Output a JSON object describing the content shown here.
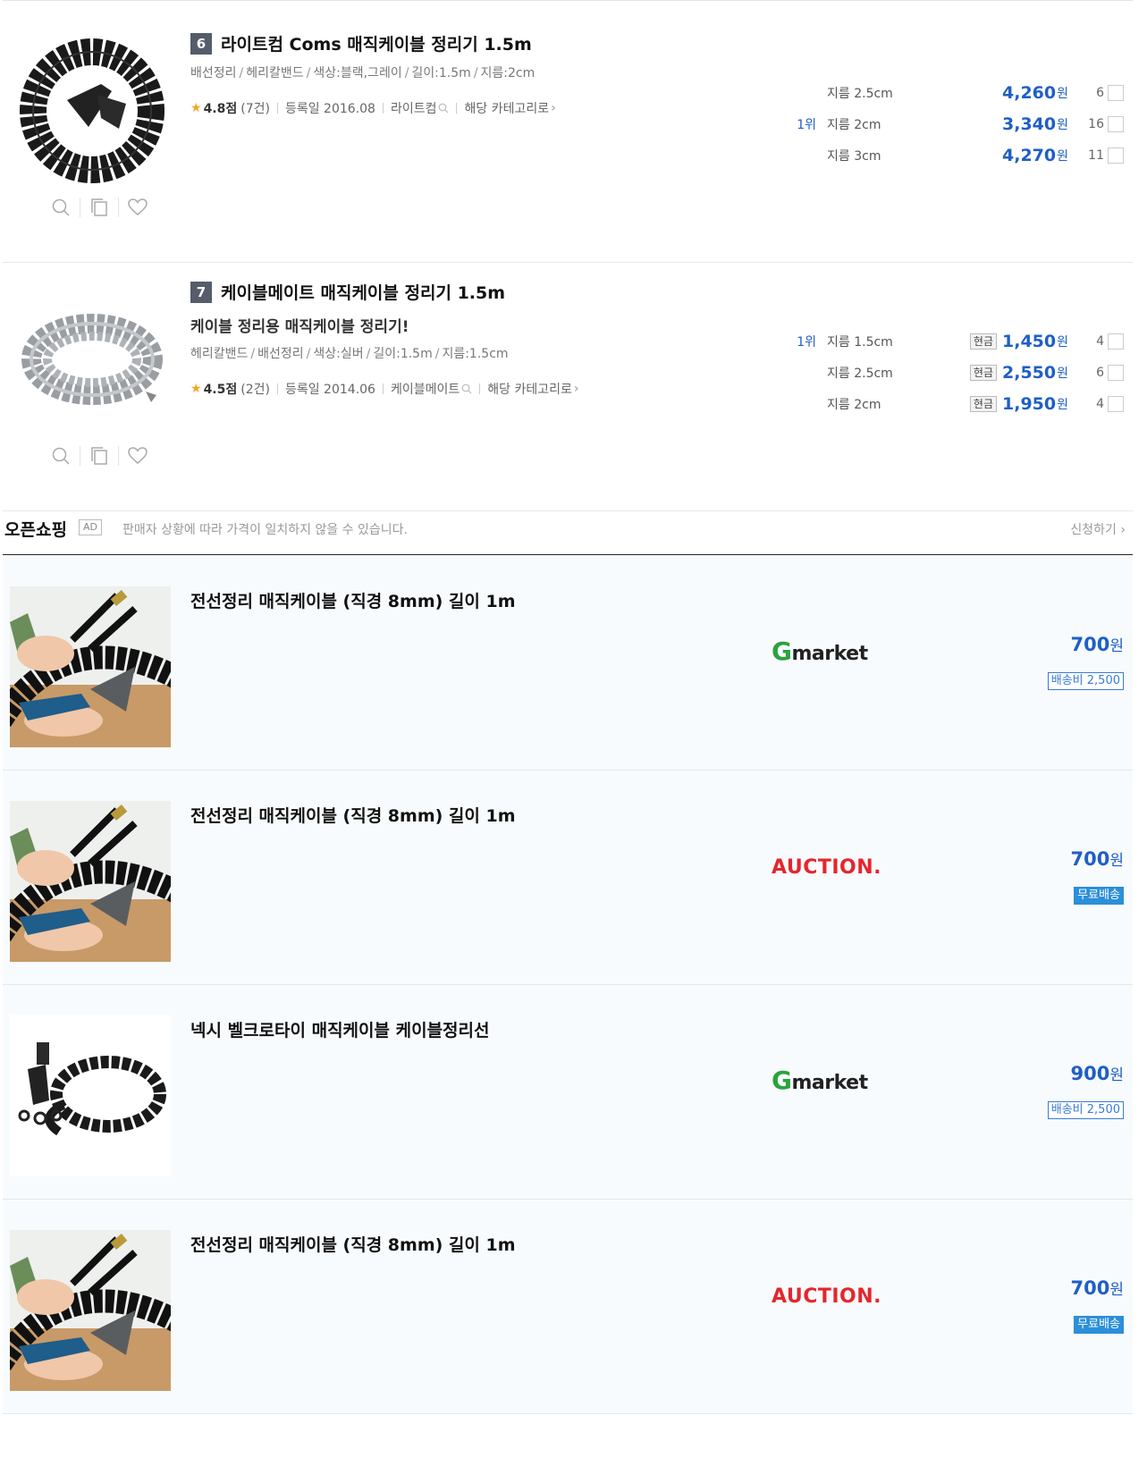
{
  "products": [
    {
      "rank": "6",
      "title": "라이트컴 Coms 매직케이블 정리기 1.5m",
      "subtitle": "",
      "specs": [
        "배선정리",
        "헤리칼밴드",
        "색상:블랙,그레이",
        "길이:1.5m",
        "지름:2cm"
      ],
      "rating": "4.8점",
      "review_count": "(7건)",
      "registered": "등록일 2016.08",
      "maker": "라이트컴",
      "category_link": "해당 카테고리로",
      "options": [
        {
          "rank": "",
          "spec": "지름 2.5cm",
          "cash": "",
          "price": "4,260",
          "unit": "원",
          "count": "6"
        },
        {
          "rank": "1위",
          "spec": "지름 2cm",
          "cash": "",
          "price": "3,340",
          "unit": "원",
          "count": "16"
        },
        {
          "rank": "",
          "spec": "지름 3cm",
          "cash": "",
          "price": "4,270",
          "unit": "원",
          "count": "11"
        }
      ]
    },
    {
      "rank": "7",
      "title": "케이블메이트 매직케이블 정리기 1.5m",
      "subtitle": "케이블 정리용 매직케이블 정리기!",
      "specs": [
        "헤리칼밴드",
        "배선정리",
        "색상:실버",
        "길이:1.5m",
        "지름:1.5cm"
      ],
      "rating": "4.5점",
      "review_count": "(2건)",
      "registered": "등록일 2014.06",
      "maker": "케이블메이트",
      "category_link": "해당 카테고리로",
      "options": [
        {
          "rank": "1위",
          "spec": "지름 1.5cm",
          "cash": "현금",
          "price": "1,450",
          "unit": "원",
          "count": "4"
        },
        {
          "rank": "",
          "spec": "지름 2.5cm",
          "cash": "현금",
          "price": "2,550",
          "unit": "원",
          "count": "6"
        },
        {
          "rank": "",
          "spec": "지름 2cm",
          "cash": "현금",
          "price": "1,950",
          "unit": "원",
          "count": "4"
        }
      ]
    }
  ],
  "open_shopping": {
    "title": "오픈쇼핑",
    "ad_label": "AD",
    "notice": "판매자 상황에 따라 가격이 일치하지 않을 수 있습니다.",
    "apply_label": "신청하기",
    "items": [
      {
        "title": "전선정리 매직케이블 (직경 8mm) 길이 1m",
        "mall": "Gmarket",
        "price": "700",
        "unit": "원",
        "shipping": "배송비 2,500",
        "shipping_type": "fee",
        "image": "cable-cutting-photo"
      },
      {
        "title": "전선정리 매직케이블 (직경 8mm) 길이 1m",
        "mall": "AUCTION.",
        "price": "700",
        "unit": "원",
        "shipping": "무료배송",
        "shipping_type": "free",
        "image": "cable-cutting-photo"
      },
      {
        "title": "넥시 벨크로타이 매직케이블 케이블정리선",
        "mall": "Gmarket",
        "price": "900",
        "unit": "원",
        "shipping": "배송비 2,500",
        "shipping_type": "fee",
        "image": "spiral-wrap-kit-photo"
      },
      {
        "title": "전선정리 매직케이블 (직경 8mm) 길이 1m",
        "mall": "AUCTION.",
        "price": "700",
        "unit": "원",
        "shipping": "무료배송",
        "shipping_type": "free",
        "image": "cable-cutting-photo"
      }
    ]
  },
  "colors": {
    "price_blue": "#1f5fc6",
    "star": "#f5a623",
    "gmarket_green": "#2aa33d",
    "auction_red": "#e5262c",
    "free_ship": "#2b8fd9"
  }
}
